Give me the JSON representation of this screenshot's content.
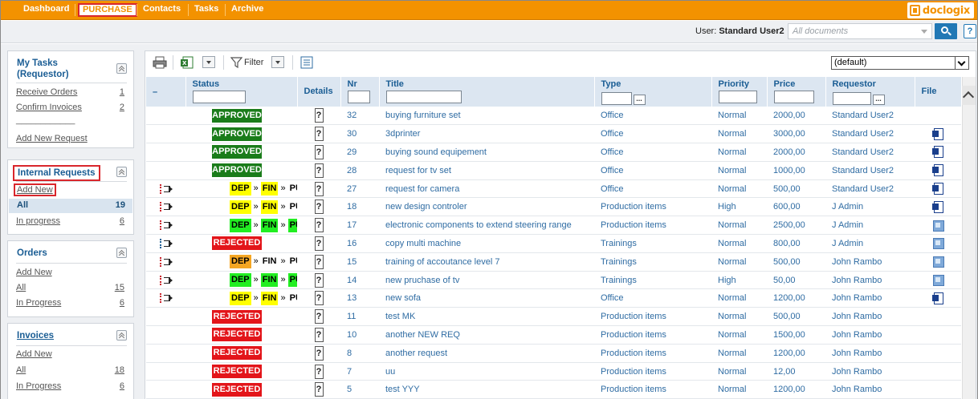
{
  "nav": {
    "items": [
      "Dashboard",
      "PURCHASE",
      "Contacts",
      "Tasks",
      "Archive"
    ],
    "logo_text": "doclogix"
  },
  "userbar": {
    "user_label": "User: ",
    "user_name": "Standard User2",
    "search_placeholder": "All documents",
    "help_label": "?"
  },
  "sidebar": {
    "my_tasks": {
      "title_line1": "My Tasks",
      "title_line2": "(Requestor)",
      "items": [
        {
          "label": "Receive Orders",
          "count": "1"
        },
        {
          "label": "Confirm Invoices",
          "count": "2"
        }
      ],
      "separator_link": "____________",
      "add_link": "Add New Request"
    },
    "internal_requests": {
      "title": "Internal Requests",
      "add_link": "Add New",
      "all_label": "All",
      "all_count": "19",
      "in_progress_label": "In progress",
      "in_progress_count": "6"
    },
    "orders": {
      "title": "Orders",
      "add_link": "Add New",
      "all_label": "All",
      "all_count": "15",
      "in_progress_label": "In Progress",
      "in_progress_count": "6"
    },
    "invoices": {
      "title": "Invoices",
      "add_link": "Add New",
      "all_label": "All",
      "all_count": "18",
      "in_progress_label": "In Progress",
      "in_progress_count": "6"
    }
  },
  "toolbar": {
    "filter_label": "Filter",
    "view_select": "(default)"
  },
  "table": {
    "headers": {
      "action": "–",
      "status": "Status",
      "details": "Details",
      "nr": "Nr",
      "title": "Title",
      "type": "Type",
      "priority": "Priority",
      "price": "Price",
      "requestor": "Requestor",
      "file": "File",
      "ellipsis": "..."
    },
    "details_label": "?",
    "rows": [
      {
        "action": "",
        "status": "APPROVED",
        "stages": [],
        "nr": "32",
        "title": "buying furniture set",
        "type": "Office",
        "priority": "Normal",
        "price": "2000,00",
        "requestor": "Standard User2",
        "file": ""
      },
      {
        "action": "",
        "status": "APPROVED",
        "stages": [],
        "nr": "30",
        "title": "3dprinter",
        "type": "Office",
        "priority": "Normal",
        "price": "3000,00",
        "requestor": "Standard User2",
        "file": "word-doc-icon"
      },
      {
        "action": "",
        "status": "APPROVED",
        "stages": [],
        "nr": "29",
        "title": "buying sound equipement",
        "type": "Office",
        "priority": "Normal",
        "price": "2000,00",
        "requestor": "Standard User2",
        "file": "word-doc-icon"
      },
      {
        "action": "",
        "status": "APPROVED",
        "stages": [],
        "nr": "28",
        "title": "request for tv set",
        "type": "Office",
        "priority": "Normal",
        "price": "1000,00",
        "requestor": "Standard User2",
        "file": "word-doc-icon"
      },
      {
        "action": "workflow-icon",
        "status": "",
        "stages": [
          {
            "label": "DEP",
            "color": "yellow"
          },
          {
            "label": "FIN",
            "color": "yellow"
          },
          {
            "label": "PUR",
            "color": "plain"
          }
        ],
        "nr": "27",
        "title": "request for camera",
        "type": "Office",
        "priority": "Normal",
        "price": "500,00",
        "requestor": "Standard User2",
        "file": "word-doc-icon"
      },
      {
        "action": "workflow-icon",
        "status": "",
        "stages": [
          {
            "label": "DEP",
            "color": "yellow"
          },
          {
            "label": "FIN",
            "color": "yellow"
          },
          {
            "label": "PUR",
            "color": "plain"
          }
        ],
        "nr": "18",
        "title": "new design controler",
        "type": "Production items",
        "priority": "High",
        "price": "600,00",
        "requestor": "J Admin",
        "file": "word-doc-icon"
      },
      {
        "action": "workflow-icon",
        "status": "",
        "stages": [
          {
            "label": "DEP",
            "color": "green"
          },
          {
            "label": "FIN",
            "color": "green"
          },
          {
            "label": "PUR",
            "color": "green"
          }
        ],
        "nr": "17",
        "title": "electronic components to extend steering range",
        "type": "Production items",
        "priority": "Normal",
        "price": "2500,00",
        "requestor": "J Admin",
        "file": "image-doc-icon"
      },
      {
        "action": "workflow-icon-blue",
        "status": "REJECTED",
        "stages": [],
        "nr": "16",
        "title": "copy multi machine",
        "type": "Trainings",
        "priority": "Normal",
        "price": "800,00",
        "requestor": "J Admin",
        "file": "image-doc-icon"
      },
      {
        "action": "workflow-icon",
        "status": "",
        "stages": [
          {
            "label": "DEP",
            "color": "orange"
          },
          {
            "label": "FIN",
            "color": "plain"
          },
          {
            "label": "PUR",
            "color": "plain"
          }
        ],
        "nr": "15",
        "title": "training of accoutance level 7",
        "type": "Trainings",
        "priority": "Normal",
        "price": "500,00",
        "requestor": "John Rambo",
        "file": "image-doc-icon"
      },
      {
        "action": "workflow-icon",
        "status": "",
        "stages": [
          {
            "label": "DEP",
            "color": "green"
          },
          {
            "label": "FIN",
            "color": "green"
          },
          {
            "label": "PUR",
            "color": "green"
          }
        ],
        "nr": "14",
        "title": "new pruchase of tv",
        "type": "Trainings",
        "priority": "High",
        "price": "50,00",
        "requestor": "John Rambo",
        "file": "image-doc-icon"
      },
      {
        "action": "workflow-icon",
        "status": "",
        "stages": [
          {
            "label": "DEP",
            "color": "yellow"
          },
          {
            "label": "FIN",
            "color": "yellow"
          },
          {
            "label": "PUR",
            "color": "plain"
          }
        ],
        "nr": "13",
        "title": "new sofa",
        "type": "Office",
        "priority": "Normal",
        "price": "1200,00",
        "requestor": "John Rambo",
        "file": "word-doc-icon"
      },
      {
        "action": "",
        "status": "REJECTED",
        "stages": [],
        "nr": "11",
        "title": "test MK",
        "type": "Production items",
        "priority": "Normal",
        "price": "500,00",
        "requestor": "John Rambo",
        "file": ""
      },
      {
        "action": "",
        "status": "REJECTED",
        "stages": [],
        "nr": "10",
        "title": "another NEW REQ",
        "type": "Production items",
        "priority": "Normal",
        "price": "1500,00",
        "requestor": "John Rambo",
        "file": ""
      },
      {
        "action": "",
        "status": "REJECTED",
        "stages": [],
        "nr": "8",
        "title": "another request",
        "type": "Production items",
        "priority": "Normal",
        "price": "1200,00",
        "requestor": "John Rambo",
        "file": ""
      },
      {
        "action": "",
        "status": "REJECTED",
        "stages": [],
        "nr": "7",
        "title": "uu",
        "type": "Production items",
        "priority": "Normal",
        "price": "12,00",
        "requestor": "John Rambo",
        "file": ""
      },
      {
        "action": "",
        "status": "REJECTED",
        "stages": [],
        "nr": "5",
        "title": "test YYY",
        "type": "Production items",
        "priority": "Normal",
        "price": "1200,00",
        "requestor": "John Rambo",
        "file": ""
      }
    ]
  },
  "colors": {
    "nav_bg": "#f39200",
    "approved": "#1a7c1a",
    "rejected": "#e3151a",
    "stage_yellow": "#ffff00",
    "stage_green": "#22ee22",
    "stage_orange": "#f5a623",
    "highlight_border": "#d9262c"
  }
}
